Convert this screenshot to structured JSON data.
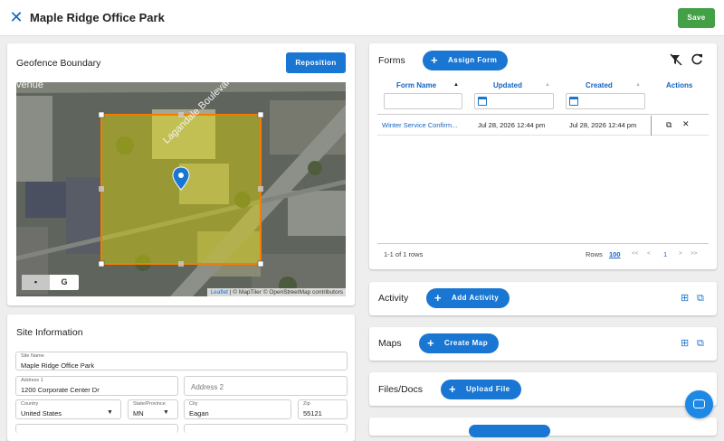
{
  "header": {
    "title": "Maple Ridge Office Park",
    "save_label": "Save",
    "close_icon": "close-icon"
  },
  "geofence": {
    "title": "Geofence Boundary",
    "reposition_label": "Reposition",
    "road_label": "Lagandale Boulevard",
    "road_label_top": "venue",
    "attribution_link": "Leaflet",
    "attribution_text": "| © MapTiler © OpenStreetMap contributors",
    "layer_buttons": [
      "map-icon",
      "google-icon"
    ],
    "google_letter": "G"
  },
  "site_info": {
    "title": "Site Information",
    "site_name": {
      "label": "Site Name",
      "value": "Maple Ridge Office Park"
    },
    "address1": {
      "label": "Address 1",
      "value": "1200 Corporate Center Dr"
    },
    "address2": {
      "placeholder": "Address 2"
    },
    "country": {
      "label": "Country",
      "value": "United States"
    },
    "state": {
      "label": "State/Province",
      "value": "MN"
    },
    "city": {
      "label": "City",
      "value": "Eagan"
    },
    "zip": {
      "label": "Zip",
      "value": "55121"
    }
  },
  "forms": {
    "title": "Forms",
    "assign_label": "Assign Form",
    "columns": [
      "Form Name",
      "Updated",
      "Created",
      "Actions"
    ],
    "rows": [
      {
        "name": "Winter Service Confirm...",
        "updated": "Jul 28, 2026 12:44 pm",
        "created": "Jul 28, 2026 12:44 pm"
      }
    ],
    "row_count": "1-1 of 1 rows",
    "rows_label": "Rows",
    "rows_per_page": "100",
    "page": "1",
    "first": "<<",
    "prev": "<",
    "next": ">",
    "last": ">>"
  },
  "activity": {
    "title": "Activity",
    "add_label": "Add Activity"
  },
  "maps": {
    "title": "Maps",
    "create_label": "Create Map"
  },
  "files": {
    "title": "Files/Docs",
    "upload_label": "Upload File"
  },
  "colors": {
    "accent": "#1976d2",
    "save": "#43a047",
    "geofence": "#f57c00"
  }
}
